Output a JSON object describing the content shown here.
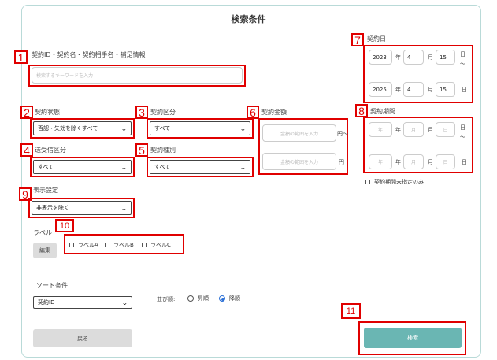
{
  "title": "検索条件",
  "markers": [
    "1",
    "2",
    "3",
    "4",
    "5",
    "6",
    "7",
    "8",
    "9",
    "10",
    "11"
  ],
  "keyword": {
    "label": "契約ID・契約名・契約相手名・補足情報",
    "placeholder": "検索するキーワードを入力"
  },
  "contract_status": {
    "label": "契約状態",
    "value": "否認・失効を除くすべて"
  },
  "contract_category": {
    "label": "契約区分",
    "value": "すべて"
  },
  "amount": {
    "label": "契約金額",
    "placeholder": "金額の範囲を入力",
    "unit_from": "円〜",
    "unit_to": "円"
  },
  "sender_category": {
    "label": "送受信区分",
    "value": "すべて"
  },
  "contract_type": {
    "label": "契約種別",
    "value": "すべて"
  },
  "display": {
    "label": "表示設定",
    "value": "非表示を除く"
  },
  "contract_date": {
    "label": "契約日",
    "from": {
      "year": "2023",
      "month": "4",
      "day": "15"
    },
    "to": {
      "year": "2025",
      "month": "4",
      "day": "15"
    },
    "year_unit": "年",
    "month_unit": "月",
    "day_unit": "日",
    "tilde": "〜"
  },
  "contract_period": {
    "label": "契約期間",
    "year_ph": "年",
    "month_ph": "月",
    "day_ph": "日",
    "year_unit": "年",
    "month_unit": "月",
    "day_unit": "日",
    "tilde": "〜",
    "unspecified_label": "契約期間未指定のみ"
  },
  "labels": {
    "label": "ラベル",
    "edit_button": "編集",
    "items": [
      "ラベルA",
      "ラベルB",
      "ラベルC"
    ]
  },
  "sort": {
    "label": "ソート条件",
    "value": "契約ID",
    "order_label": "並び順:",
    "asc": "昇順",
    "desc": "降順",
    "selected": "降順"
  },
  "buttons": {
    "back": "戻る",
    "search": "検索"
  }
}
